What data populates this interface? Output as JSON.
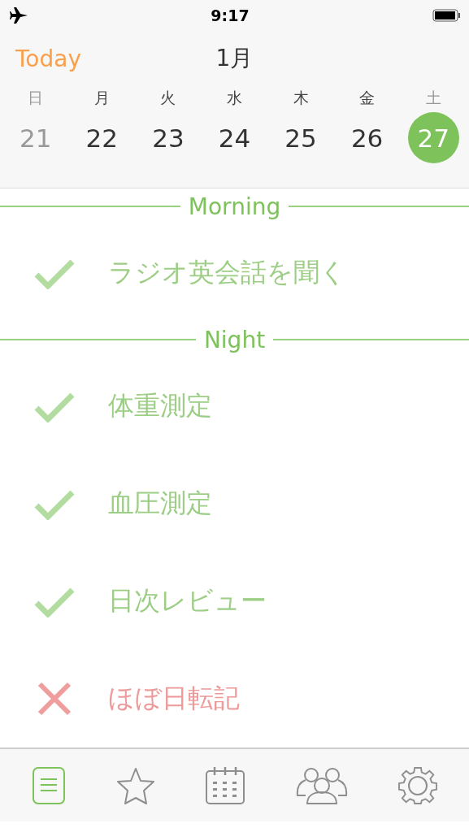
{
  "status_bar": {
    "time": "9:17"
  },
  "header": {
    "today_button": "Today",
    "month": "1月"
  },
  "weekdays": [
    {
      "label": "日",
      "muted": true
    },
    {
      "label": "月",
      "muted": false
    },
    {
      "label": "火",
      "muted": false
    },
    {
      "label": "水",
      "muted": false
    },
    {
      "label": "木",
      "muted": false
    },
    {
      "label": "金",
      "muted": false
    },
    {
      "label": "土",
      "muted": true
    }
  ],
  "dates": [
    {
      "label": "21",
      "muted": true,
      "selected": false
    },
    {
      "label": "22",
      "muted": false,
      "selected": false
    },
    {
      "label": "23",
      "muted": false,
      "selected": false
    },
    {
      "label": "24",
      "muted": false,
      "selected": false
    },
    {
      "label": "25",
      "muted": false,
      "selected": false
    },
    {
      "label": "26",
      "muted": false,
      "selected": false
    },
    {
      "label": "27",
      "muted": false,
      "selected": true
    }
  ],
  "sections": [
    {
      "title": "Morning",
      "tasks": [
        {
          "label": "ラジオ英会話を聞く",
          "kind": "done"
        }
      ]
    },
    {
      "title": "Night",
      "tasks": [
        {
          "label": "体重測定",
          "kind": "done"
        },
        {
          "label": "血圧測定",
          "kind": "done"
        },
        {
          "label": "日次レビュー",
          "kind": "done"
        },
        {
          "label": "ほぼ日転記",
          "kind": "failed"
        }
      ]
    }
  ],
  "tab_bar": [
    {
      "kind": "list",
      "selected": true
    },
    {
      "kind": "star",
      "selected": false
    },
    {
      "kind": "calendar",
      "selected": false
    },
    {
      "kind": "people",
      "selected": false
    },
    {
      "kind": "settings",
      "selected": false
    }
  ]
}
